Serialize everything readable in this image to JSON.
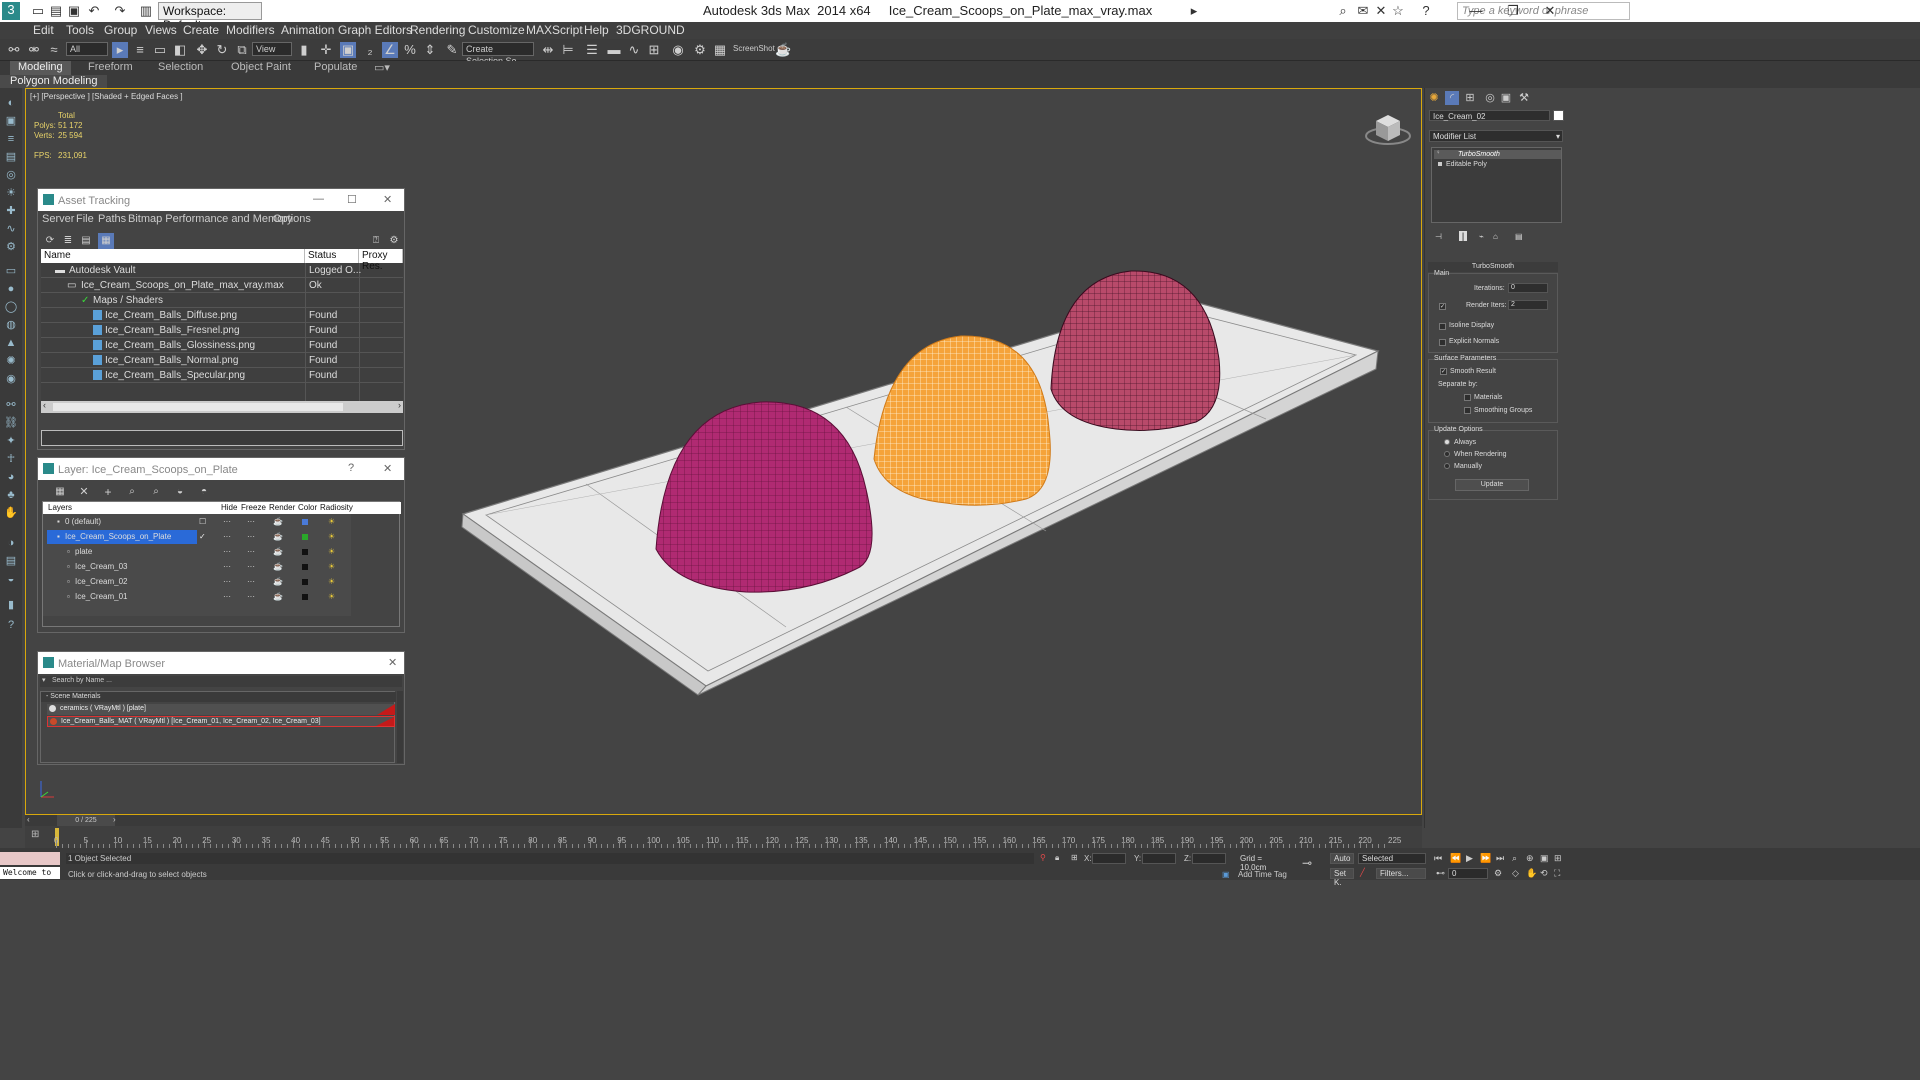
{
  "titlebar": {
    "workspace": "Workspace: Default",
    "title": "Autodesk 3ds Max  2014 x64     Ice_Cream_Scoops_on_Plate_max_vray.max",
    "search_placeholder": "Type a keyword or phrase"
  },
  "menu": [
    "Edit",
    "Tools",
    "Group",
    "Views",
    "Create",
    "Modifiers",
    "Animation",
    "Graph Editors",
    "Rendering",
    "Customize",
    "MAXScript",
    "Help",
    "3DGROUND"
  ],
  "toolbar": {
    "filter_select": "All",
    "ref_coord_select": "View",
    "selection_set": "Create Selection Se",
    "screenshot_label": "ScreenShot"
  },
  "ribbon": {
    "tabs": [
      "Modeling",
      "Freeform",
      "Selection",
      "Object Paint",
      "Populate"
    ],
    "active_tab": "Modeling",
    "subpanel": "Polygon Modeling"
  },
  "viewport": {
    "label": "[+] [Perspective ] [Shaded + Edged Faces ]",
    "stats_total": "Total",
    "polys_label": "Polys:",
    "polys_value": "51 172",
    "verts_label": "Verts:",
    "verts_value": "25 594",
    "fps_label": "FPS:",
    "fps_value": "231,091"
  },
  "asset_tracking": {
    "title": "Asset Tracking",
    "menu": [
      "Server",
      "File",
      "Paths",
      "Bitmap Performance and Memory",
      "Options"
    ],
    "columns": [
      "Name",
      "Status",
      "Proxy Res."
    ],
    "rows": [
      {
        "name": "Autodesk Vault",
        "status": "Logged O..."
      },
      {
        "name": "Ice_Cream_Scoops_on_Plate_max_vray.max",
        "status": "Ok"
      },
      {
        "name": "Maps / Shaders",
        "status": ""
      },
      {
        "name": "Ice_Cream_Balls_Diffuse.png",
        "status": "Found"
      },
      {
        "name": "Ice_Cream_Balls_Fresnel.png",
        "status": "Found"
      },
      {
        "name": "Ice_Cream_Balls_Glossiness.png",
        "status": "Found"
      },
      {
        "name": "Ice_Cream_Balls_Normal.png",
        "status": "Found"
      },
      {
        "name": "Ice_Cream_Balls_Specular.png",
        "status": "Found"
      }
    ]
  },
  "layer_window": {
    "title": "Layer: Ice_Cream_Scoops_on_Plate",
    "help": "?",
    "columns": [
      "Layers",
      "Hide",
      "Freeze",
      "Render",
      "Color",
      "Radiosity"
    ],
    "rows": [
      {
        "name": "0 (default)",
        "color": "#4a7ad8"
      },
      {
        "name": "Ice_Cream_Scoops_on_Plate",
        "color": "#2aa82a"
      },
      {
        "name": "plate",
        "color": "#111111"
      },
      {
        "name": "Ice_Cream_03",
        "color": "#111111"
      },
      {
        "name": "Ice_Cream_02",
        "color": "#111111"
      },
      {
        "name": "Ice_Cream_01",
        "color": "#111111"
      }
    ]
  },
  "material_browser": {
    "title": "Material/Map Browser",
    "search_placeholder": "Search by Name ...",
    "section": "- Scene Materials",
    "items": [
      "ceramics  ( VRayMtl )  [plate]",
      "Ice_Cream_Balls_MAT  ( VRayMtl )  [Ice_Cream_01, Ice_Cream_02, Ice_Cream_03]"
    ]
  },
  "command_panel": {
    "object_name": "Ice_Cream_02",
    "modifier_list": "Modifier List",
    "stack": [
      "TurboSmooth",
      "Editable Poly"
    ],
    "rollout_title": "TurboSmooth",
    "main_label": "Main",
    "iterations_label": "Iterations:",
    "iterations_value": "0",
    "render_iters_label": "Render Iters:",
    "render_iters_value": "2",
    "isoline_label": "Isoline Display",
    "explicit_normals_label": "Explicit Normals",
    "surface_params_label": "Surface Parameters",
    "smooth_result_label": "Smooth Result",
    "separate_by_label": "Separate by:",
    "materials_label": "Materials",
    "smoothing_groups_label": "Smoothing Groups",
    "update_options_label": "Update Options",
    "always_label": "Always",
    "when_rendering_label": "When Rendering",
    "manually_label": "Manually",
    "update_button": "Update"
  },
  "timeline": {
    "frame_counter": "0 / 225",
    "ticks": [
      "0",
      "5",
      "10",
      "15",
      "20",
      "25",
      "30",
      "35",
      "40",
      "45",
      "50",
      "55",
      "60",
      "65",
      "70",
      "75",
      "80",
      "85",
      "90",
      "95",
      "100",
      "105",
      "110",
      "115",
      "120",
      "125",
      "130",
      "135",
      "140",
      "145",
      "150",
      "155",
      "160",
      "165",
      "170",
      "175",
      "180",
      "185",
      "190",
      "195",
      "200",
      "205",
      "210",
      "215",
      "220",
      "225"
    ]
  },
  "statusbar": {
    "maxscript": "Welcome to",
    "selection_status": "1 Object Selected",
    "prompt": "Click or click-and-drag to select objects",
    "x_label": "X:",
    "y_label": "Y:",
    "z_label": "Z:",
    "grid": "Grid = 10,0cm",
    "add_time_tag": "Add Time Tag",
    "auto_label": "Auto",
    "selected_label": "Selected",
    "set_key_label": "Set K.",
    "filters_label": "Filters...",
    "frame_value": "0"
  }
}
